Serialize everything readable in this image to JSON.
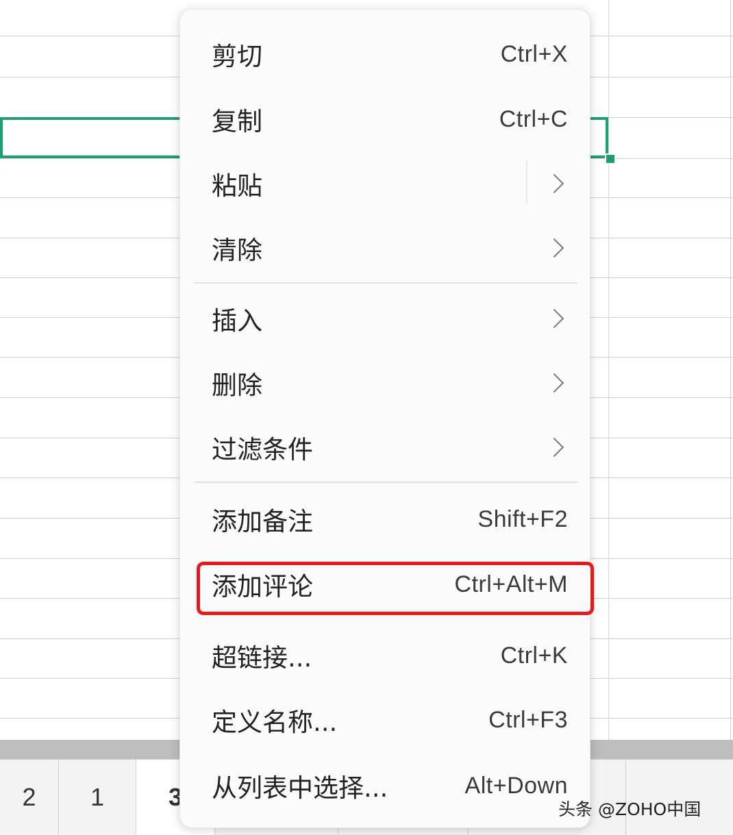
{
  "sheet_tabs": [
    {
      "label": "2"
    },
    {
      "label": "1"
    },
    {
      "label": "3"
    }
  ],
  "context_menu": {
    "items": [
      {
        "label": "剪切",
        "shortcut": "Ctrl+X"
      },
      {
        "label": "复制",
        "shortcut": "Ctrl+C"
      },
      {
        "label": "粘贴",
        "submenu": true
      },
      {
        "label": "清除",
        "submenu": true
      },
      {
        "label": "插入",
        "submenu": true
      },
      {
        "label": "删除",
        "submenu": true
      },
      {
        "label": "过滤条件",
        "submenu": true
      },
      {
        "label": "添加备注",
        "shortcut": "Shift+F2"
      },
      {
        "label": "添加评论",
        "shortcut": "Ctrl+Alt+M",
        "highlighted": true
      },
      {
        "label": "超链接...",
        "shortcut": "Ctrl+K"
      },
      {
        "label": "定义名称...",
        "shortcut": "Ctrl+F3"
      },
      {
        "label": "从列表中选择...",
        "shortcut": "Alt+Down"
      }
    ]
  },
  "watermark": "头条 @ZOHO中国",
  "colors": {
    "selection": "#1f9e6e",
    "highlight_box": "#e51a1a",
    "menu_background": "#fbfbfd"
  }
}
